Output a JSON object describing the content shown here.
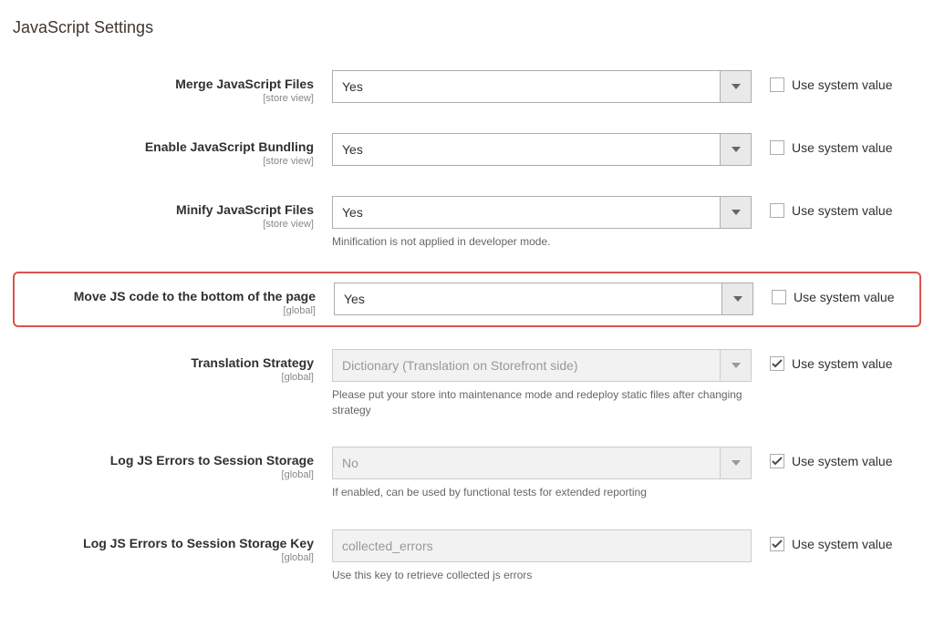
{
  "section_title": "JavaScript Settings",
  "use_system_value_label": "Use system value",
  "fields": {
    "merge_js": {
      "label": "Merge JavaScript Files",
      "scope": "[store view]",
      "value": "Yes",
      "use_system": false
    },
    "bundling": {
      "label": "Enable JavaScript Bundling",
      "scope": "[store view]",
      "value": "Yes",
      "use_system": false
    },
    "minify": {
      "label": "Minify JavaScript Files",
      "scope": "[store view]",
      "value": "Yes",
      "note": "Minification is not applied in developer mode.",
      "use_system": false
    },
    "move_bottom": {
      "label": "Move JS code to the bottom of the page",
      "scope": "[global]",
      "value": "Yes",
      "use_system": false
    },
    "translation": {
      "label": "Translation Strategy",
      "scope": "[global]",
      "value": "Dictionary (Translation on Storefront side)",
      "note": "Please put your store into maintenance mode and redeploy static files after changing strategy",
      "use_system": true
    },
    "log_errors": {
      "label": "Log JS Errors to Session Storage",
      "scope": "[global]",
      "value": "No",
      "note": "If enabled, can be used by functional tests for extended reporting",
      "use_system": true
    },
    "log_errors_key": {
      "label": "Log JS Errors to Session Storage Key",
      "scope": "[global]",
      "value": "collected_errors",
      "note": "Use this key to retrieve collected js errors",
      "use_system": true
    }
  }
}
